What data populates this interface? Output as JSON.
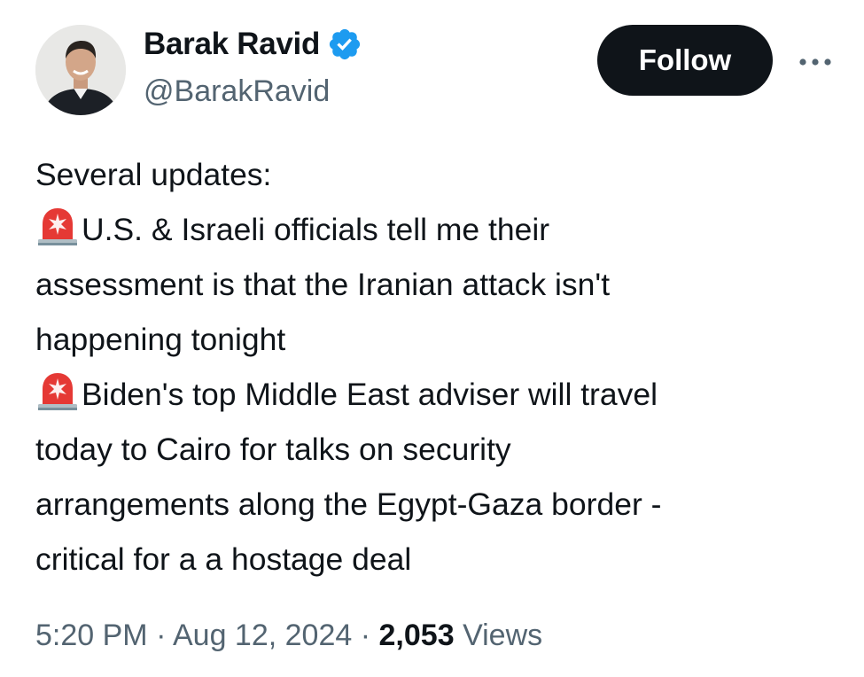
{
  "author": {
    "display_name": "Barak Ravid",
    "handle": "@BarakRavid",
    "verified_icon": "verified-badge-icon",
    "verified_color": "#1d9bf0"
  },
  "actions": {
    "follow_label": "Follow",
    "more_icon": "more-horizontal-icon"
  },
  "tweet": {
    "lines": [
      "Several updates:",
      "U.S. & Israeli officials tell me their",
      "assessment is that the Iranian attack isn't",
      "happening tonight",
      "Biden's top Middle East adviser will travel",
      "today to Cairo for talks on security",
      "arrangements along the Egypt-Gaza border -",
      "critical for a a hostage deal"
    ],
    "emoji_icon": "rotating-light-icon"
  },
  "meta": {
    "time": "5:20 PM",
    "separator": "·",
    "date": "Aug 12, 2024",
    "views_count": "2,053",
    "views_label": "Views"
  },
  "colors": {
    "text_primary": "#0f1419",
    "text_secondary": "#536471",
    "follow_bg": "#0f1419",
    "follow_text": "#ffffff"
  }
}
